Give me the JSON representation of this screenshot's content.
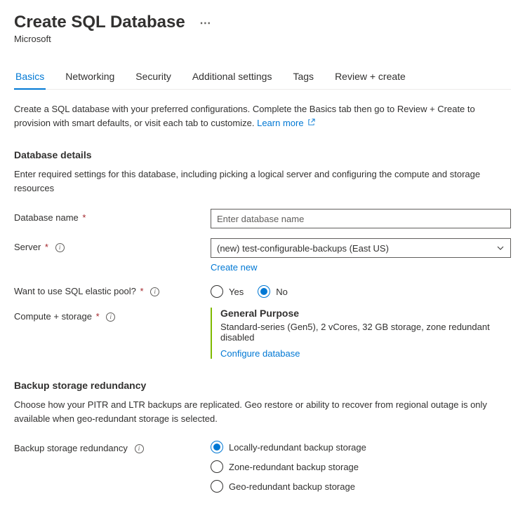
{
  "header": {
    "title": "Create SQL Database",
    "subtitle": "Microsoft"
  },
  "tabs": {
    "items": [
      {
        "label": "Basics"
      },
      {
        "label": "Networking"
      },
      {
        "label": "Security"
      },
      {
        "label": "Additional settings"
      },
      {
        "label": "Tags"
      },
      {
        "label": "Review + create"
      }
    ]
  },
  "intro": {
    "text": "Create a SQL database with your preferred configurations. Complete the Basics tab then go to Review + Create to provision with smart defaults, or visit each tab to customize. ",
    "learn_more": "Learn more"
  },
  "database_details": {
    "header": "Database details",
    "desc": "Enter required settings for this database, including picking a logical server and configuring the compute and storage resources",
    "db_name_label": "Database name",
    "db_name_placeholder": "Enter database name",
    "server_label": "Server",
    "server_value": "(new) test-configurable-backups (East US)",
    "create_new": "Create new",
    "elastic_label": "Want to use SQL elastic pool?",
    "yes": "Yes",
    "no": "No",
    "compute_label": "Compute + storage",
    "compute_tier": "General Purpose",
    "compute_desc": "Standard-series (Gen5), 2 vCores, 32 GB storage, zone redundant disabled",
    "configure": "Configure database"
  },
  "backup": {
    "header": "Backup storage redundancy",
    "desc": "Choose how your PITR and LTR backups are replicated. Geo restore or ability to recover from regional outage is only available when geo-redundant storage is selected.",
    "label": "Backup storage redundancy",
    "opt_local": "Locally-redundant backup storage",
    "opt_zone": "Zone-redundant backup storage",
    "opt_geo": "Geo-redundant backup storage"
  }
}
